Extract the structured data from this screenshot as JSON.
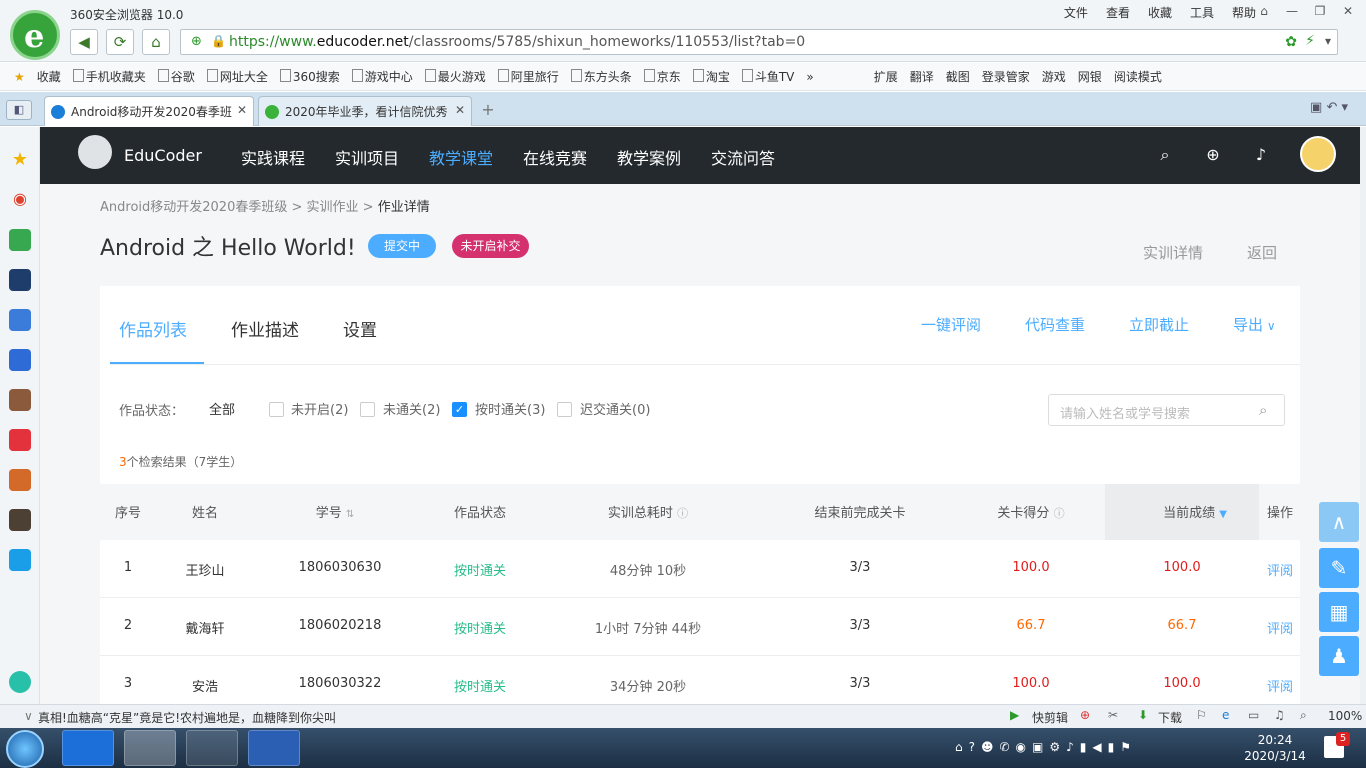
{
  "browser": {
    "title": "360安全浏览器 10.0",
    "menus": [
      "文件",
      "查看",
      "收藏",
      "工具",
      "帮助"
    ],
    "url_scheme": "https://www.",
    "url_domain": "educoder.net",
    "url_path": "/classrooms/5785/shixun_homeworks/110553/list?tab=0",
    "favorites": [
      "收藏",
      "手机收藏夹",
      "谷歌",
      "网址大全",
      "360搜索",
      "游戏中心",
      "最火游戏",
      "阿里旅行",
      "东方头条",
      "京东",
      "淘宝",
      "斗鱼TV",
      "»"
    ],
    "right_tools": [
      "扩展",
      "翻译",
      "截图",
      "登录管家",
      "游戏",
      "网银",
      "阅读模式"
    ],
    "tabs": [
      {
        "label": "Android移动开发2020春季班",
        "active": true
      },
      {
        "label": "2020年毕业季，看计信院优秀",
        "active": false
      }
    ]
  },
  "app_nav": {
    "brand": "EduCoder",
    "items": [
      "实践课程",
      "实训项目",
      "教学课堂",
      "在线竞赛",
      "教学案例",
      "交流问答"
    ],
    "active_index": 2
  },
  "breadcrumb": {
    "part1": "Android移动开发2020春季班级",
    "sep1": " > ",
    "part2": "实训作业",
    "sep2": " > ",
    "part3": "作业详情"
  },
  "page": {
    "title": "Android 之 Hello World!",
    "badge_submitting": "提交中",
    "badge_no_makeup": "未开启补交",
    "link_details": "实训详情",
    "link_back": "返回"
  },
  "panel": {
    "tabs": [
      "作品列表",
      "作业描述",
      "设置"
    ],
    "actions": [
      "一键评阅",
      "代码查重",
      "立即截止",
      "导出"
    ],
    "filter_label": "作品状态：",
    "filter_all": "全部",
    "filters": [
      {
        "label": "未开启(2)",
        "checked": false
      },
      {
        "label": "未通关(2)",
        "checked": false
      },
      {
        "label": "按时通关(3)",
        "checked": true
      },
      {
        "label": "迟交通关(0)",
        "checked": false
      }
    ],
    "search_placeholder": "请输入姓名或学号搜索",
    "result_count": "3",
    "result_text": "个检索结果（7学生）"
  },
  "table": {
    "headers": [
      "序号",
      "姓名",
      "学号",
      "作品状态",
      "实训总耗时",
      "结束前完成关卡",
      "关卡得分",
      "当前成绩",
      "操作"
    ],
    "rows": [
      {
        "no": "1",
        "name": "王珍山",
        "id": "1806030630",
        "status": "按时通关",
        "time": "48分钟 10秒",
        "levels": "3/3",
        "score": "100.0",
        "grade": "100.0",
        "op": "评阅"
      },
      {
        "no": "2",
        "name": "戴海轩",
        "id": "1806020218",
        "status": "按时通关",
        "time": "1小时 7分钟 44秒",
        "levels": "3/3",
        "score": "66.7",
        "grade": "66.7",
        "op": "评阅"
      },
      {
        "no": "3",
        "name": "安浩",
        "id": "1806030322",
        "status": "按时通关",
        "time": "34分钟 20秒",
        "levels": "3/3",
        "score": "100.0",
        "grade": "100.0",
        "op": "评阅"
      }
    ]
  },
  "statusbar": {
    "news": "真相!血糖高“克星”竟是它!农村遍地是，血糖降到你尖叫",
    "quick_cut": "快剪辑",
    "download": "下载",
    "zoom": "100%"
  },
  "taskbar": {
    "time": "20:24",
    "date": "2020/3/14",
    "notif_count": "5"
  },
  "colors": {
    "accent": "#4cacff",
    "nav_bg": "#24292d",
    "pass": "#29bd8b",
    "full_score": "#e01c1c",
    "partial_score": "#ff6800",
    "badge_blue": "#4cacff",
    "badge_red": "#d5316f"
  }
}
